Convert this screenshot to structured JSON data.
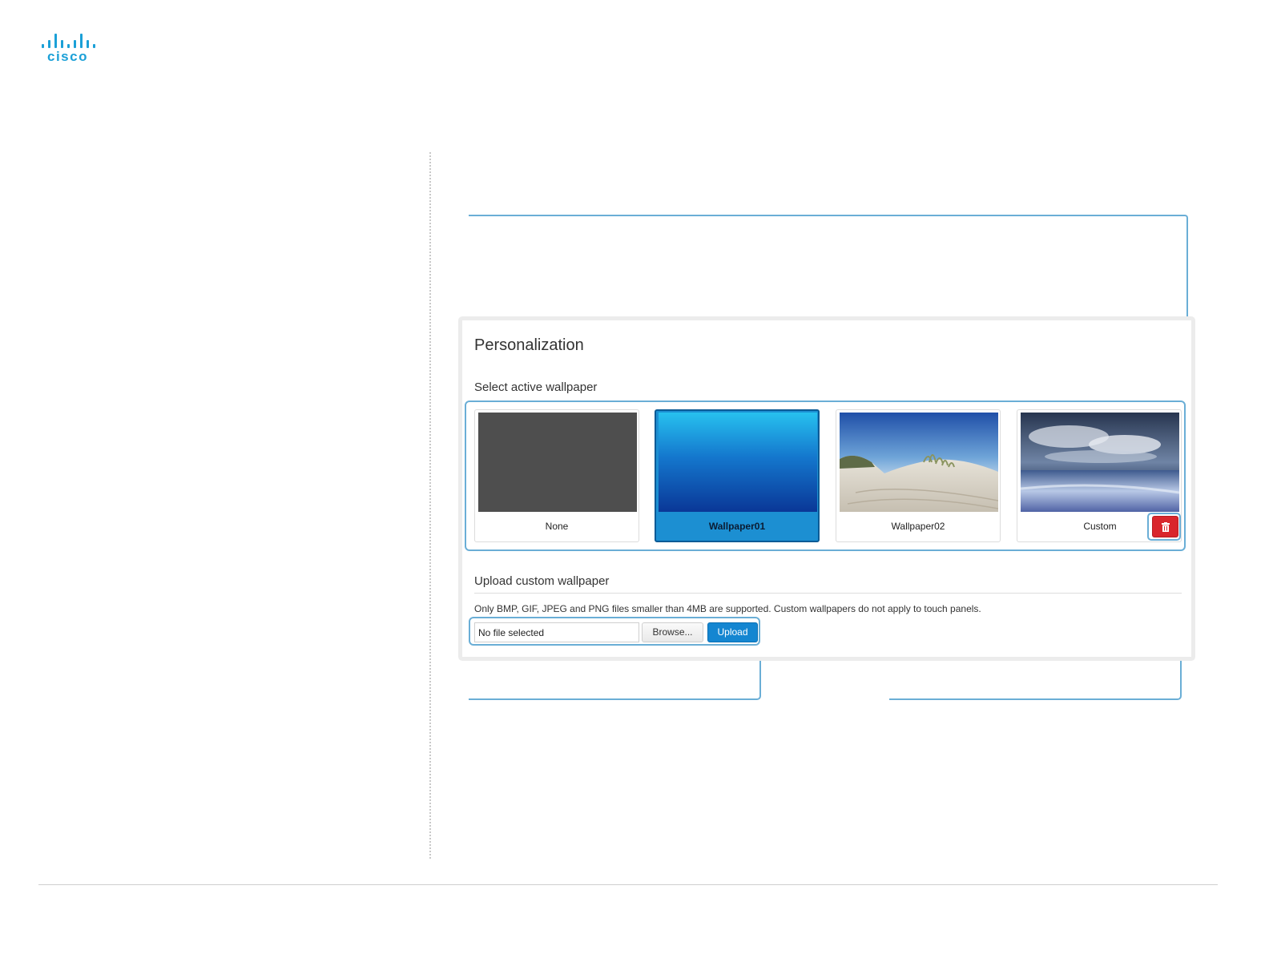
{
  "logo": {
    "text": "cisco"
  },
  "panel": {
    "title": "Personalization",
    "select_label": "Select active wallpaper",
    "wallpapers": [
      {
        "label": "None",
        "selected": false
      },
      {
        "label": "Wallpaper01",
        "selected": true
      },
      {
        "label": "Wallpaper02",
        "selected": false
      },
      {
        "label": "Custom",
        "selected": false
      }
    ],
    "upload_label": "Upload custom wallpaper",
    "upload_note": "Only BMP, GIF, JPEG and PNG files smaller than 4MB are supported. Custom wallpapers do not apply to touch panels.",
    "file_value": "No file selected",
    "browse_label": "Browse...",
    "upload_button": "Upload"
  },
  "colors": {
    "accent": "#1ba0d7",
    "callout": "#6aaed6",
    "selected_card": "#1c8fd2",
    "delete": "#d9262c",
    "upload": "#1486d1"
  },
  "icons": {
    "delete": "trash-icon"
  }
}
